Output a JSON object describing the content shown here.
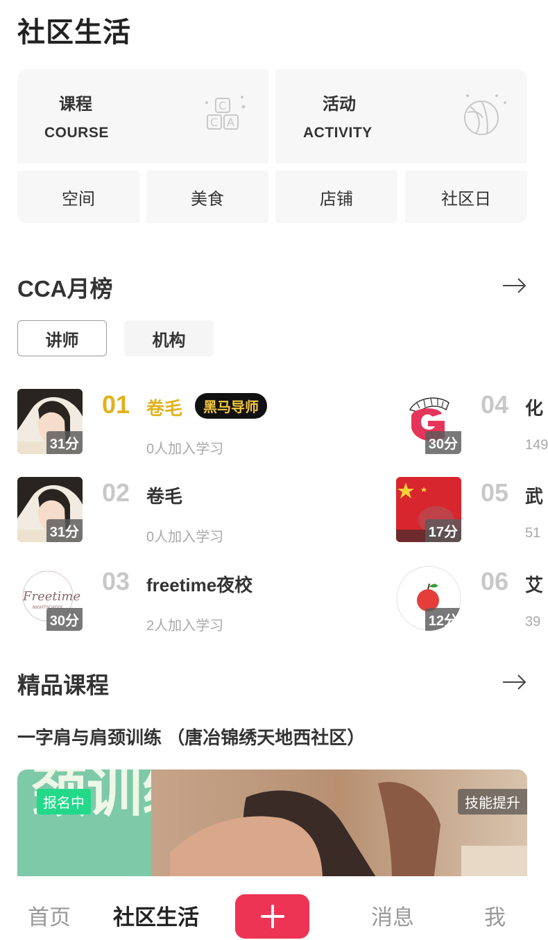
{
  "page_title": "社区生活",
  "categories": {
    "course": {
      "cn": "课程",
      "en": "COURSE",
      "icon": "course-blocks-icon"
    },
    "activity": {
      "cn": "活动",
      "en": "ACTIVITY",
      "icon": "ball-icon"
    },
    "small": [
      "空间",
      "美食",
      "店铺",
      "社区日"
    ]
  },
  "ranking": {
    "title": "CCA月榜",
    "tabs": [
      "讲师",
      "机构"
    ],
    "active_tab": "讲师",
    "items": [
      {
        "rank": "01",
        "name": "卷毛",
        "badge": "黑马导师",
        "score": "31分",
        "sub": "0人加入学习"
      },
      {
        "rank": "02",
        "name": "卷毛",
        "score": "31分",
        "sub": "0人加入学习"
      },
      {
        "rank": "03",
        "name": "freetime夜校",
        "score": "30分",
        "sub": "2人加入学习"
      },
      {
        "rank": "04",
        "name": "化",
        "score": "30分",
        "sub": "149"
      },
      {
        "rank": "05",
        "name": "武",
        "score": "17分",
        "sub": "51"
      },
      {
        "rank": "06",
        "name": "艾",
        "score": "12分",
        "sub": "39"
      }
    ],
    "avatar3_text": {
      "script": "Freetime",
      "sub": "NIGHTSCHOOL"
    }
  },
  "featured": {
    "title": "精品课程",
    "course_title": "一字肩与肩颈训练 （唐冶锦绣天地西社区）",
    "tag_status": "报名中",
    "tag_category": "技能提升",
    "image_text": "颈训练"
  },
  "nav": {
    "items": [
      "首页",
      "社区生活",
      "消息",
      "我"
    ],
    "active": "社区生活",
    "plus_icon": "plus-icon"
  },
  "colors": {
    "accent": "#ee3455",
    "gold": "#e0b21c",
    "tag_green": "#22d98a"
  }
}
